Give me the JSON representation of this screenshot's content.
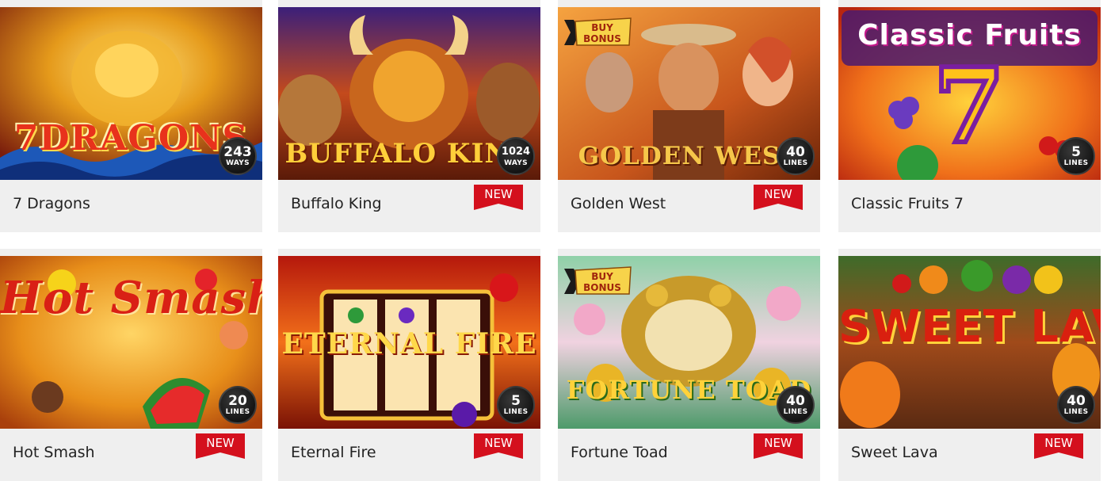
{
  "games": [
    {
      "title": "7 Dragons",
      "logo": "7DRAGONS",
      "count": "243",
      "unit": "WAYS",
      "is_new": false,
      "buy_bonus": false
    },
    {
      "title": "Buffalo King",
      "logo": "BUFFALO KING",
      "count": "1024",
      "unit": "WAYS",
      "is_new": true,
      "buy_bonus": false
    },
    {
      "title": "Golden West",
      "logo": "GOLDEN WEST",
      "count": "40",
      "unit": "LINES",
      "is_new": true,
      "buy_bonus": true
    },
    {
      "title": "Classic Fruits 7",
      "logo": "Classic Fruits",
      "count": "5",
      "unit": "LINES",
      "is_new": false,
      "buy_bonus": false
    },
    {
      "title": "Hot Smash",
      "logo": "Hot Smash",
      "count": "20",
      "unit": "LINES",
      "is_new": true,
      "buy_bonus": false
    },
    {
      "title": "Eternal Fire",
      "logo": "ETERNAL FIRE",
      "count": "5",
      "unit": "LINES",
      "is_new": true,
      "buy_bonus": false
    },
    {
      "title": "Fortune Toad",
      "logo": "FORTUNE TOAD",
      "count": "40",
      "unit": "LINES",
      "is_new": true,
      "buy_bonus": true
    },
    {
      "title": "Sweet Lava",
      "logo": "SWEET LAVA",
      "count": "40",
      "unit": "LINES",
      "is_new": true,
      "buy_bonus": false
    }
  ],
  "new_label": "NEW",
  "buy_bonus": {
    "line1": "BUY",
    "line2": "BONUS"
  },
  "colors": {
    "new_tag": "#d4101d",
    "card_bg": "#efefef",
    "title_text": "#222222",
    "badge_bg": "#1a1a1a"
  }
}
